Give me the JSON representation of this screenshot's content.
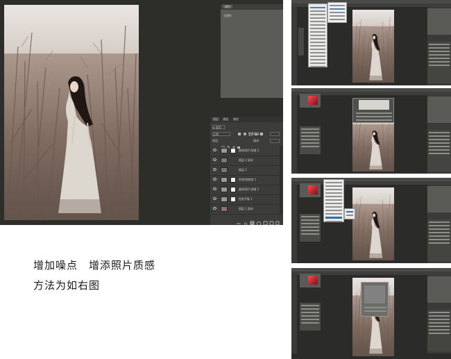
{
  "caption": {
    "line1_a": "增加噪点",
    "line1_b": "增添照片质感",
    "line2": "方法为如右图"
  },
  "main_screenshot": {
    "properties_panel": {
      "tab": "属性",
      "text": "无属性"
    },
    "layers_panel": {
      "tabs": [
        "图层",
        "通道",
        "路径"
      ],
      "filter_label": "ρ 类型",
      "blend_mode": "正常",
      "opacity_label": "不透明度:",
      "lock_label": "锁定:",
      "fill_label": "填充:",
      "layers": [
        {
          "name": "曲线/照片滤镜 2",
          "thumb": "adjust",
          "mask": true
        },
        {
          "name": "图层 2 副本",
          "thumb": "gray",
          "mask": false
        },
        {
          "name": "图层 2",
          "thumb": "gray",
          "mask": false
        },
        {
          "name": "色相/饱和度 1",
          "thumb": "adjust",
          "mask": true
        },
        {
          "name": "曲线/照片滤镜 1",
          "thumb": "adjust",
          "mask": true
        },
        {
          "name": "色彩平衡 1",
          "thumb": "adjust",
          "mask": true
        },
        {
          "name": "图层 1 副本",
          "thumb": "photo",
          "mask": false
        }
      ]
    }
  },
  "colors": {
    "ps_background": "#2d2e2a",
    "panel": "#3c3d3a",
    "panel_light": "#5b5c58",
    "highlight": "#2f6ea8"
  }
}
